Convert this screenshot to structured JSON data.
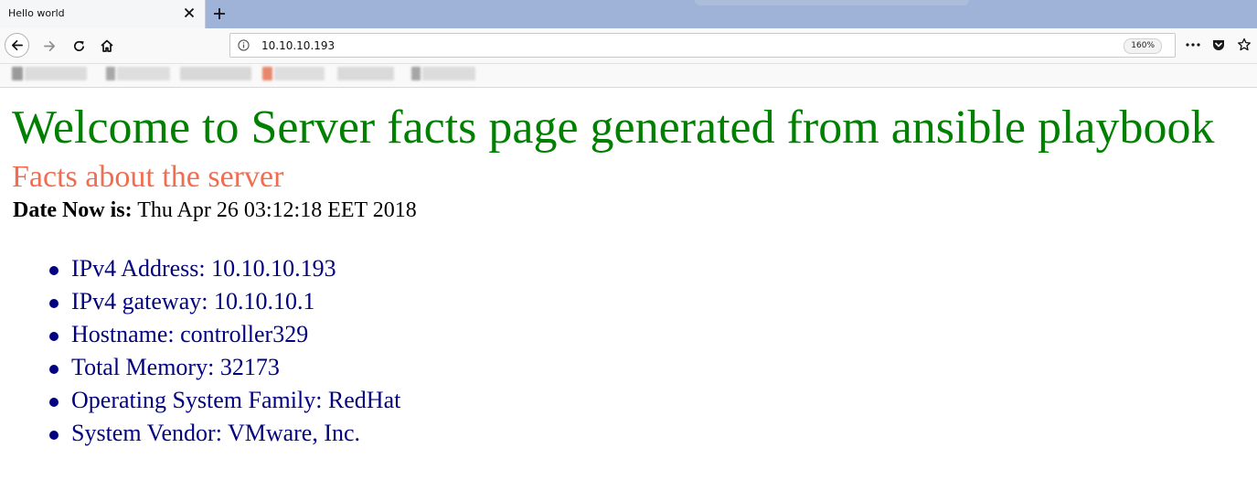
{
  "browser": {
    "tab": {
      "title": "Hello world"
    },
    "url": "10.10.10.193",
    "zoom": "160%"
  },
  "page": {
    "heading": "Welcome to Server facts page generated from ansible playbook",
    "subheading": "Facts about the server",
    "date_label": "Date Now is:",
    "date_value": "Thu Apr 26 03:12:18 EET 2018",
    "facts": [
      "IPv4 Address: 10.10.10.193",
      "IPv4 gateway: 10.10.10.1",
      "Hostname: controller329",
      "Total Memory: 32173",
      "Operating System Family: RedHat",
      "System Vendor: VMware, Inc."
    ]
  },
  "colors": {
    "heading": "#008000",
    "subheading": "#f26d50",
    "facts": "#000080",
    "tabstrip": "#9fb3d8"
  }
}
